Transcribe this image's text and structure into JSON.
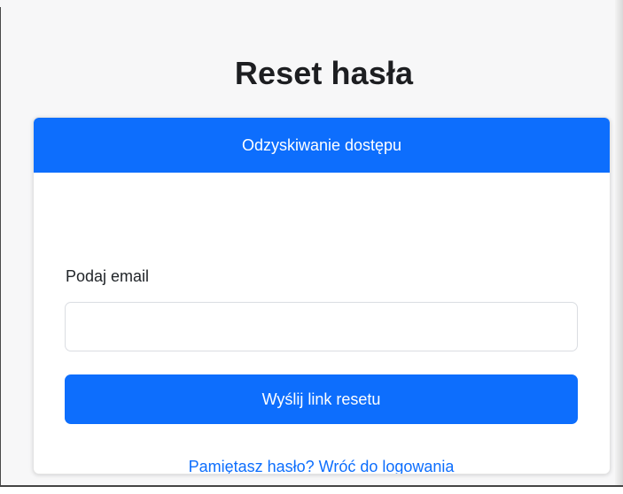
{
  "page": {
    "title": "Reset hasła"
  },
  "card": {
    "header": "Odzyskiwanie dostępu",
    "email_label": "Podaj email",
    "email_value": "",
    "submit_label": "Wyślij link resetu",
    "login_link": "Pamiętasz hasło? Wróć do logowania"
  },
  "colors": {
    "primary": "#0d6efd",
    "background": "#f7f7f8"
  }
}
